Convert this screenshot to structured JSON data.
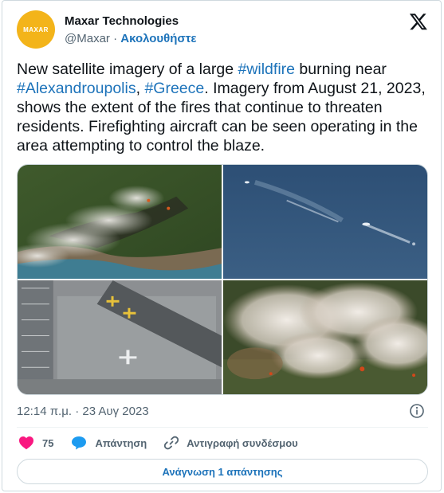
{
  "author": {
    "name": "Maxar Technologies",
    "handle": "@Maxar",
    "separator": " · ",
    "follow_label": "Ακολουθήστε",
    "avatar_text": "MAXAR"
  },
  "tweet": {
    "segments": [
      {
        "text": "New satellite imagery of a large ",
        "tag": false
      },
      {
        "text": "#wildfire",
        "tag": true
      },
      {
        "text": " burning near ",
        "tag": false
      },
      {
        "text": "#Alexandroupolis",
        "tag": true
      },
      {
        "text": ", ",
        "tag": false
      },
      {
        "text": "#Greece",
        "tag": true
      },
      {
        "text": ". Imagery from August 21, 2023, shows the extent of the fires that continue to threaten residents. Firefighting aircraft can be seen operating in the area attempting to control the blaze.",
        "tag": false
      }
    ]
  },
  "media": {
    "images": [
      {
        "name": "wildfire-coast-image"
      },
      {
        "name": "aircraft-over-sea-image"
      },
      {
        "name": "airport-aircraft-image"
      },
      {
        "name": "fire-smoke-closeup-image"
      }
    ]
  },
  "meta": {
    "timestamp": "12:14 π.μ. · 23 Αυγ 2023"
  },
  "actions": {
    "like_count": "75",
    "reply_label": "Απάντηση",
    "copy_link_label": "Αντιγραφή συνδέσμου"
  },
  "read_replies_label": "Ανάγνωση 1 απάντησης",
  "colors": {
    "link": "#1d73ba",
    "heart": "#f91880",
    "reply_bubble": "#1d9bf0",
    "avatar": "#f3b41a"
  }
}
